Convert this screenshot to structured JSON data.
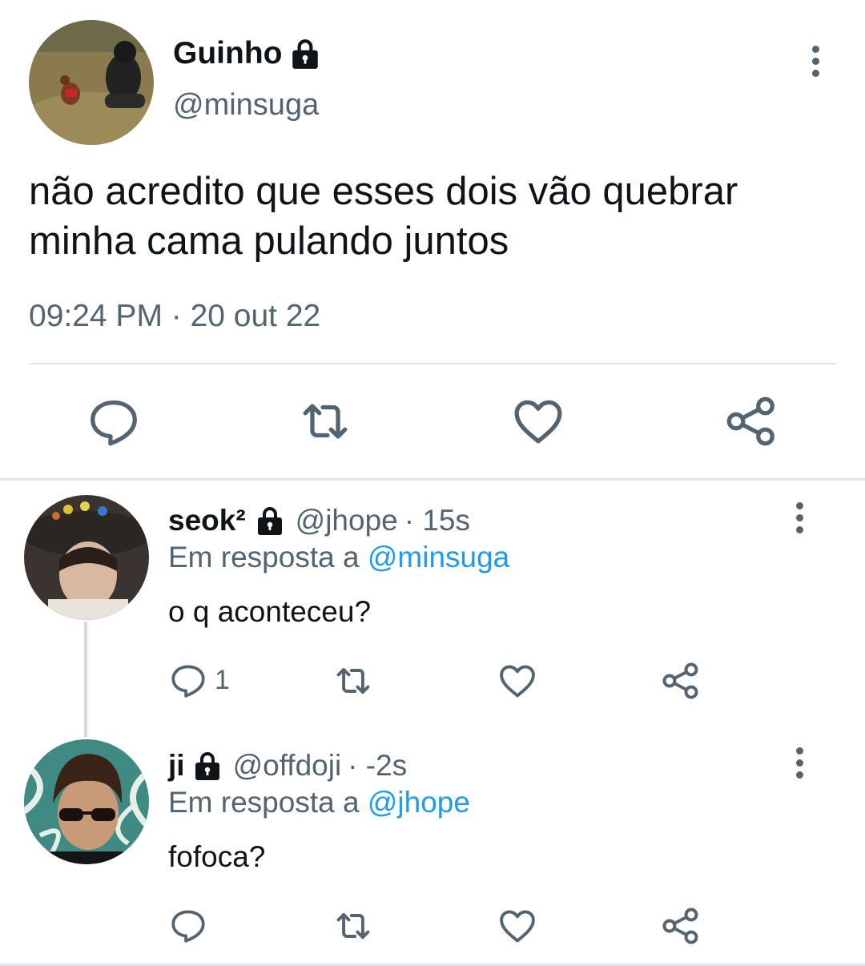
{
  "main_tweet": {
    "display_name": "Guinho",
    "handle": "@minsuga",
    "text_line1": "não acredito que esses dois vão quebrar",
    "text_line2": "minha cama pulando juntos",
    "timestamp": "09:24 PM · 20 out 22"
  },
  "replies": [
    {
      "display_name": "seok²",
      "handle": "@jhope",
      "time": "· 15s",
      "reply_prefix": "Em resposta a",
      "reply_to": "@minsuga",
      "text": "o q aconteceu?",
      "reply_count": "1"
    },
    {
      "display_name": "ji",
      "handle": "@offdoji",
      "time": "· -2s",
      "reply_prefix": "Em resposta a",
      "reply_to": "@jhope",
      "text": "fofoca?"
    }
  ],
  "colors": {
    "text": "#0f1419",
    "secondary": "#536471",
    "link": "#1d9bf0",
    "divider": "#e1e5e8"
  },
  "icons": [
    "lock-icon",
    "more-vertical-icon",
    "reply-icon",
    "retweet-icon",
    "like-icon",
    "share-icon"
  ]
}
